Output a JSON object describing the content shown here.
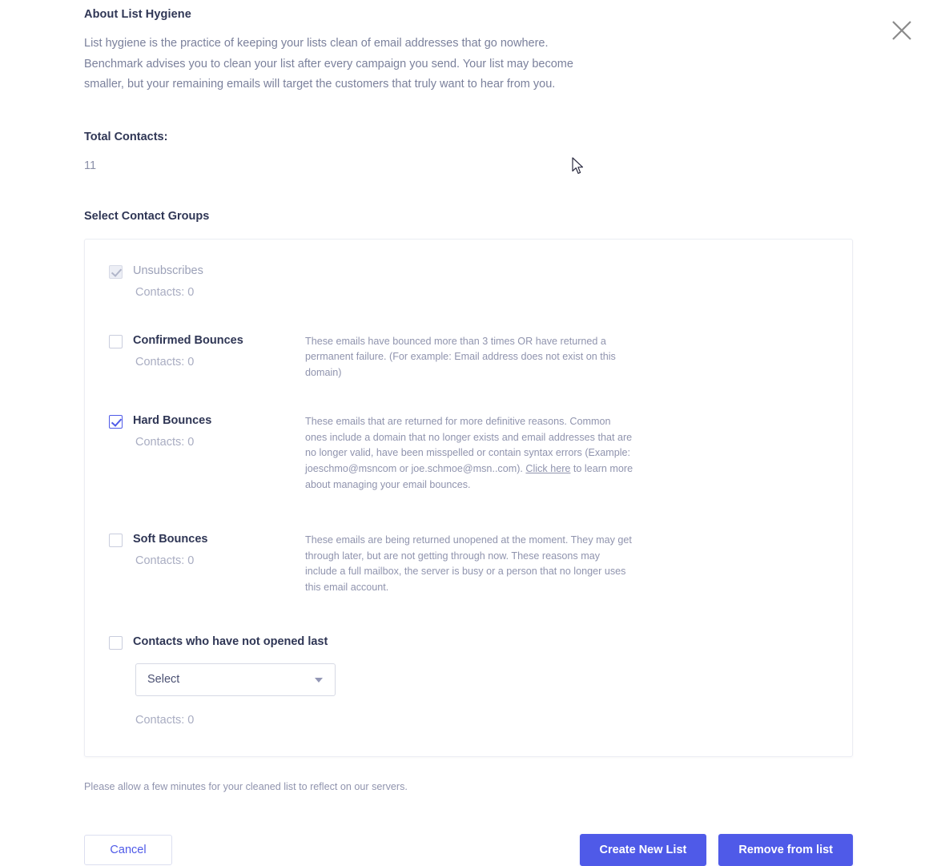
{
  "modal": {
    "close_icon": "close-icon",
    "about": {
      "heading": "About List Hygiene",
      "body": "List hygiene is the practice of keeping your lists clean of email addresses that go nowhere. Benchmark advises you to clean your list after every campaign you send. Your list may become smaller, but your remaining emails will target the customers that truly want to hear from you."
    },
    "total_contacts": {
      "label": "Total Contacts:",
      "value": "11"
    },
    "groups_heading": "Select Contact Groups",
    "groups": [
      {
        "name": "unsubscribes",
        "label": "Unsubscribes",
        "count_label": "Contacts: 0",
        "checked": true,
        "disabled": true,
        "description": ""
      },
      {
        "name": "confirmed-bounces",
        "label": "Confirmed Bounces",
        "count_label": "Contacts: 0",
        "checked": false,
        "disabled": false,
        "description": "These emails have bounced more than 3 times OR have returned a permanent failure. (For example: Email address does not exist on this domain)"
      },
      {
        "name": "hard-bounces",
        "label": "Hard Bounces",
        "count_label": "Contacts: 0",
        "checked": true,
        "disabled": false,
        "description_part1": "These emails that are returned for more definitive reasons. Common ones include a domain that no longer exists and email addresses that are no longer valid, have been misspelled or contain syntax errors (Example: joeschmo@msncom or joe.schmoe@msn..com). ",
        "description_link": "Click here",
        "description_part2": " to learn more about managing your email bounces."
      },
      {
        "name": "soft-bounces",
        "label": "Soft Bounces",
        "count_label": "Contacts: 0",
        "checked": false,
        "disabled": false,
        "description": "These emails are being returned unopened at the moment. They may get through later, but are not getting through now. These reasons may include a full mailbox, the server is busy or a person that no longer uses this email account."
      },
      {
        "name": "not-opened",
        "label": "Contacts who have not opened last",
        "count_label": "Contacts: 0",
        "checked": false,
        "disabled": false,
        "select_value": "Select",
        "description": ""
      }
    ],
    "note": "Please allow a few minutes for your cleaned list to reflect on our servers.",
    "buttons": {
      "cancel": "Cancel",
      "create_new_list": "Create New List",
      "remove_from_list": "Remove from list"
    }
  },
  "colors": {
    "accent": "#4f5ae8",
    "heading": "#2f3655",
    "muted": "#9094ae",
    "border": "#ebedf3"
  }
}
